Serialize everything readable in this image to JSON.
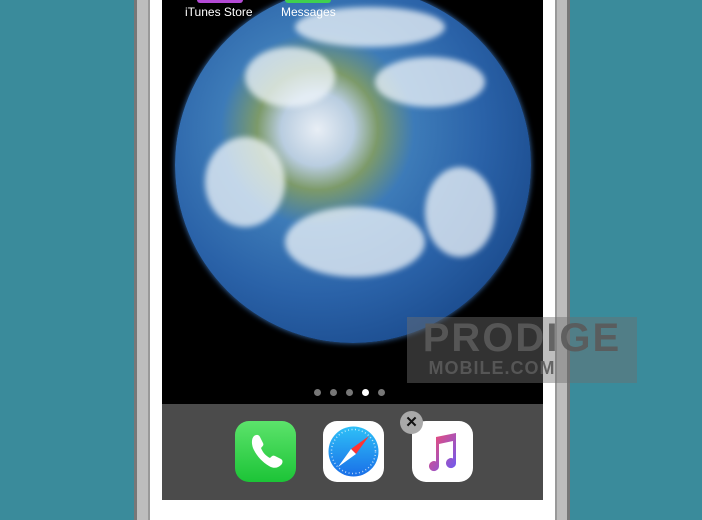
{
  "home_screen": {
    "apps_top": [
      {
        "label": "iTunes Store",
        "color": "#b44bd6"
      },
      {
        "label": "Messages",
        "color": "#3fd04f"
      }
    ],
    "page_dots": {
      "count": 5,
      "active": 4
    },
    "dock": [
      {
        "name": "Phone",
        "icon": "phone-icon",
        "color": "#2fd04a"
      },
      {
        "name": "Safari",
        "icon": "safari-compass-icon",
        "color": "#1a8cf0"
      },
      {
        "name": "Music",
        "icon": "music-note-icon",
        "color": "#f2f2f2",
        "delete_badge": "✕"
      }
    ]
  },
  "watermark": {
    "line1": "PRODIGE",
    "line2": "MOBILE.COM"
  },
  "colors": {
    "background": "#3a8b9b",
    "dock": "#4b4b4b"
  }
}
